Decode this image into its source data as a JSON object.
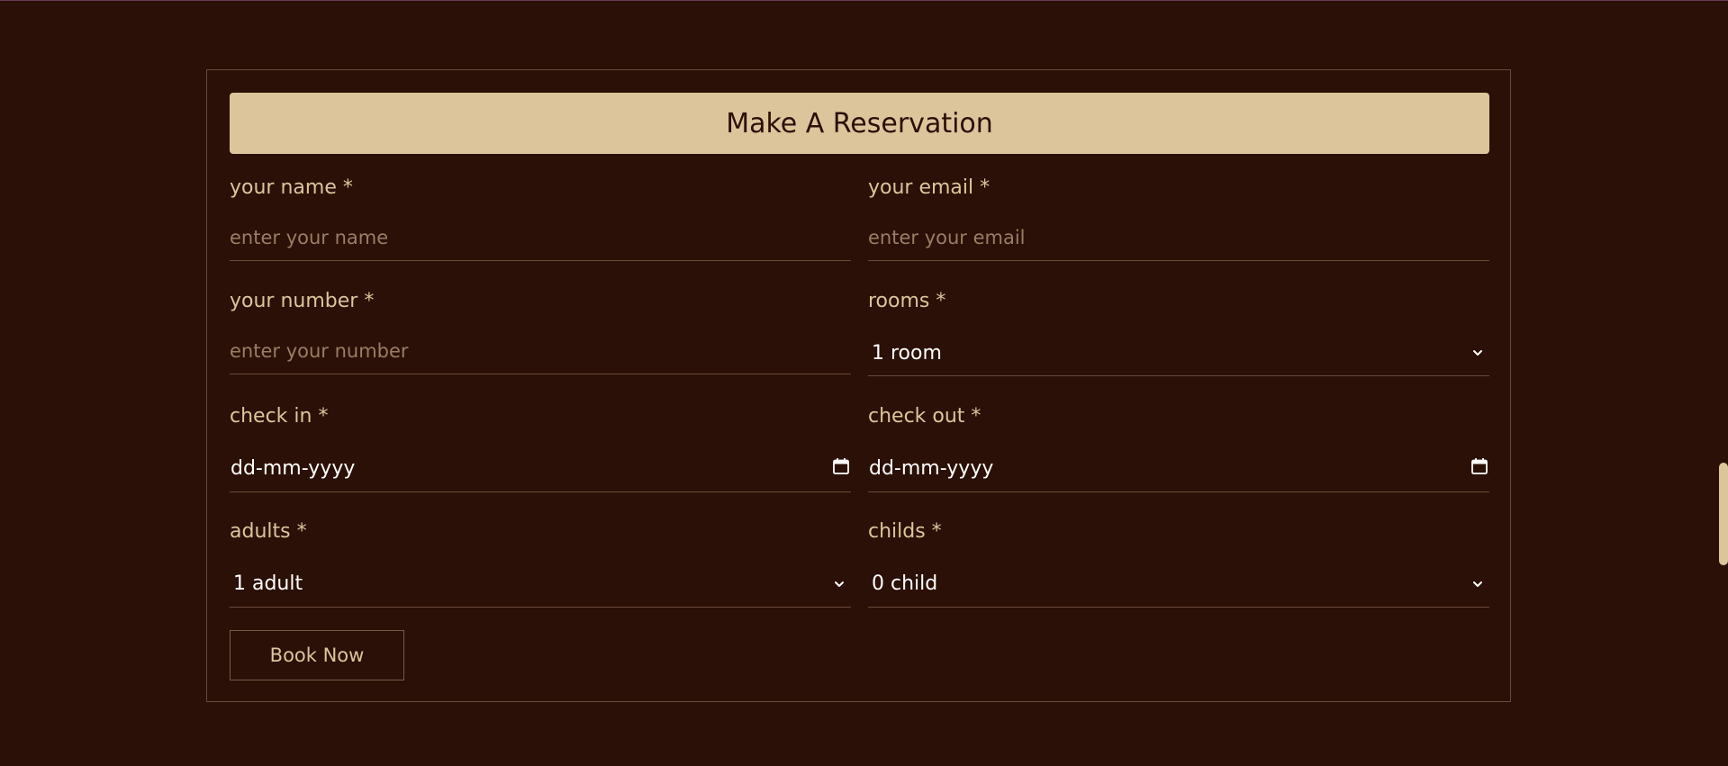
{
  "form": {
    "title": "Make A Reservation",
    "name": {
      "label": "your name *",
      "placeholder": "enter your name"
    },
    "email": {
      "label": "your email *",
      "placeholder": "enter your email"
    },
    "number": {
      "label": "your number *",
      "placeholder": "enter your number"
    },
    "rooms": {
      "label": "rooms *",
      "selected": "1 room"
    },
    "check_in": {
      "label": "check in *",
      "value": "dd-mm-yyyy"
    },
    "check_out": {
      "label": "check out *",
      "value": "dd-mm-yyyy"
    },
    "adults": {
      "label": "adults *",
      "selected": "1 adult"
    },
    "childs": {
      "label": "childs *",
      "selected": "0 child"
    },
    "submit_label": "Book Now"
  },
  "colors": {
    "background": "#2a1006",
    "accent": "#dcc59b",
    "border": "#6b4a3a",
    "placeholder": "#9b7d64"
  },
  "icons": {
    "select": "chevron-down-icon",
    "date": "calendar-icon"
  }
}
